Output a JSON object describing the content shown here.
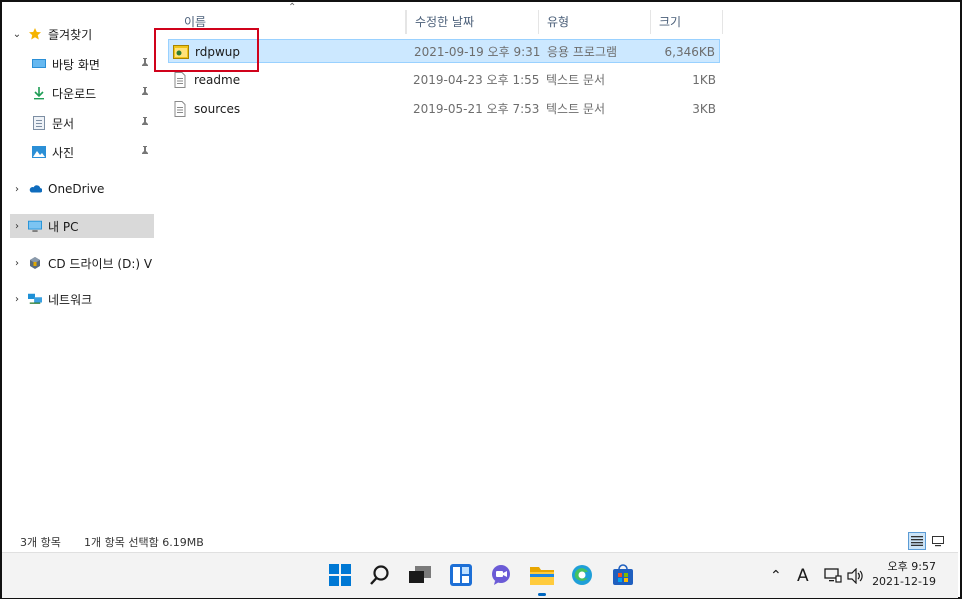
{
  "nav": {
    "quick_access": "즐겨찾기",
    "desktop": "바탕 화면",
    "downloads": "다운로드",
    "documents": "문서",
    "pictures": "사진",
    "onedrive": "OneDrive",
    "this_pc": "내 PC",
    "cd_drive": "CD 드라이브 (D:) V",
    "network": "네트워크"
  },
  "columns": {
    "name": "이름",
    "modified": "수정한 날짜",
    "type": "유형",
    "size": "크기"
  },
  "files": [
    {
      "name": "rdpwup",
      "modified": "2021-09-19 오후 9:31",
      "type": "응용 프로그램",
      "size": "6,346KB",
      "icon": "application-icon",
      "selected": true
    },
    {
      "name": "readme",
      "modified": "2019-04-23 오후 1:55",
      "type": "텍스트 문서",
      "size": "1KB",
      "icon": "text-file-icon",
      "selected": false
    },
    {
      "name": "sources",
      "modified": "2019-05-21 오후 7:53",
      "type": "텍스트 문서",
      "size": "3KB",
      "icon": "text-file-icon",
      "selected": false
    }
  ],
  "status": {
    "item_count": "3개 항목",
    "selection": "1개 항목 선택함 6.19MB"
  },
  "taskbar": {
    "ime": "A",
    "time": "오후 9:57",
    "date": "2021-12-19"
  },
  "colors": {
    "selection_bg": "#cce8ff",
    "highlight_box": "#d0021b",
    "accent": "#0067c0"
  }
}
